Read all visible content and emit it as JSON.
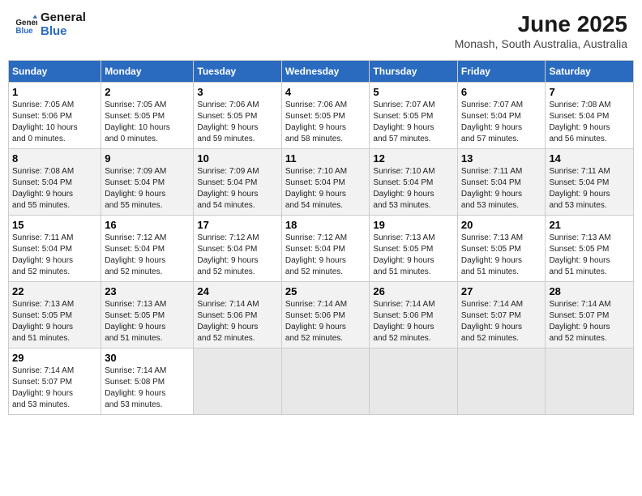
{
  "logo": {
    "line1": "General",
    "line2": "Blue"
  },
  "title": "June 2025",
  "subtitle": "Monash, South Australia, Australia",
  "weekdays": [
    "Sunday",
    "Monday",
    "Tuesday",
    "Wednesday",
    "Thursday",
    "Friday",
    "Saturday"
  ],
  "weeks": [
    [
      {
        "day": "1",
        "sunrise": "7:05 AM",
        "sunset": "5:06 PM",
        "daylight": "10 hours and 0 minutes."
      },
      {
        "day": "2",
        "sunrise": "7:05 AM",
        "sunset": "5:05 PM",
        "daylight": "10 hours and 0 minutes."
      },
      {
        "day": "3",
        "sunrise": "7:06 AM",
        "sunset": "5:05 PM",
        "daylight": "9 hours and 59 minutes."
      },
      {
        "day": "4",
        "sunrise": "7:06 AM",
        "sunset": "5:05 PM",
        "daylight": "9 hours and 58 minutes."
      },
      {
        "day": "5",
        "sunrise": "7:07 AM",
        "sunset": "5:05 PM",
        "daylight": "9 hours and 57 minutes."
      },
      {
        "day": "6",
        "sunrise": "7:07 AM",
        "sunset": "5:04 PM",
        "daylight": "9 hours and 57 minutes."
      },
      {
        "day": "7",
        "sunrise": "7:08 AM",
        "sunset": "5:04 PM",
        "daylight": "9 hours and 56 minutes."
      }
    ],
    [
      {
        "day": "8",
        "sunrise": "7:08 AM",
        "sunset": "5:04 PM",
        "daylight": "9 hours and 55 minutes."
      },
      {
        "day": "9",
        "sunrise": "7:09 AM",
        "sunset": "5:04 PM",
        "daylight": "9 hours and 55 minutes."
      },
      {
        "day": "10",
        "sunrise": "7:09 AM",
        "sunset": "5:04 PM",
        "daylight": "9 hours and 54 minutes."
      },
      {
        "day": "11",
        "sunrise": "7:10 AM",
        "sunset": "5:04 PM",
        "daylight": "9 hours and 54 minutes."
      },
      {
        "day": "12",
        "sunrise": "7:10 AM",
        "sunset": "5:04 PM",
        "daylight": "9 hours and 53 minutes."
      },
      {
        "day": "13",
        "sunrise": "7:11 AM",
        "sunset": "5:04 PM",
        "daylight": "9 hours and 53 minutes."
      },
      {
        "day": "14",
        "sunrise": "7:11 AM",
        "sunset": "5:04 PM",
        "daylight": "9 hours and 53 minutes."
      }
    ],
    [
      {
        "day": "15",
        "sunrise": "7:11 AM",
        "sunset": "5:04 PM",
        "daylight": "9 hours and 52 minutes."
      },
      {
        "day": "16",
        "sunrise": "7:12 AM",
        "sunset": "5:04 PM",
        "daylight": "9 hours and 52 minutes."
      },
      {
        "day": "17",
        "sunrise": "7:12 AM",
        "sunset": "5:04 PM",
        "daylight": "9 hours and 52 minutes."
      },
      {
        "day": "18",
        "sunrise": "7:12 AM",
        "sunset": "5:04 PM",
        "daylight": "9 hours and 52 minutes."
      },
      {
        "day": "19",
        "sunrise": "7:13 AM",
        "sunset": "5:05 PM",
        "daylight": "9 hours and 51 minutes."
      },
      {
        "day": "20",
        "sunrise": "7:13 AM",
        "sunset": "5:05 PM",
        "daylight": "9 hours and 51 minutes."
      },
      {
        "day": "21",
        "sunrise": "7:13 AM",
        "sunset": "5:05 PM",
        "daylight": "9 hours and 51 minutes."
      }
    ],
    [
      {
        "day": "22",
        "sunrise": "7:13 AM",
        "sunset": "5:05 PM",
        "daylight": "9 hours and 51 minutes."
      },
      {
        "day": "23",
        "sunrise": "7:13 AM",
        "sunset": "5:05 PM",
        "daylight": "9 hours and 51 minutes."
      },
      {
        "day": "24",
        "sunrise": "7:14 AM",
        "sunset": "5:06 PM",
        "daylight": "9 hours and 52 minutes."
      },
      {
        "day": "25",
        "sunrise": "7:14 AM",
        "sunset": "5:06 PM",
        "daylight": "9 hours and 52 minutes."
      },
      {
        "day": "26",
        "sunrise": "7:14 AM",
        "sunset": "5:06 PM",
        "daylight": "9 hours and 52 minutes."
      },
      {
        "day": "27",
        "sunrise": "7:14 AM",
        "sunset": "5:07 PM",
        "daylight": "9 hours and 52 minutes."
      },
      {
        "day": "28",
        "sunrise": "7:14 AM",
        "sunset": "5:07 PM",
        "daylight": "9 hours and 52 minutes."
      }
    ],
    [
      {
        "day": "29",
        "sunrise": "7:14 AM",
        "sunset": "5:07 PM",
        "daylight": "9 hours and 53 minutes."
      },
      {
        "day": "30",
        "sunrise": "7:14 AM",
        "sunset": "5:08 PM",
        "daylight": "9 hours and 53 minutes."
      },
      null,
      null,
      null,
      null,
      null
    ]
  ]
}
